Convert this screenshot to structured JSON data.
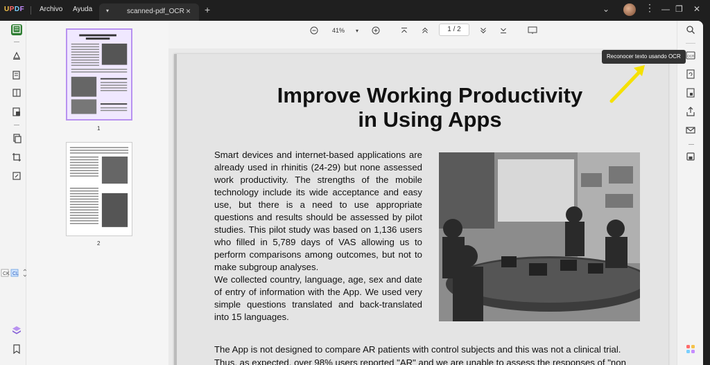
{
  "app": {
    "logo": "UPDF"
  },
  "menu": {
    "file": "Archivo",
    "help": "Ayuda"
  },
  "tab": {
    "name": "scanned-pdf_OCR",
    "close": "×",
    "new": "+"
  },
  "toolbar": {
    "zoom": "41%",
    "page_current": "1",
    "page_sep": "/",
    "page_total": "2"
  },
  "thumbnails": [
    {
      "number": "1"
    },
    {
      "number": "2"
    }
  ],
  "document": {
    "title_line1": "Improve Working Productivity",
    "title_line2": "in Using Apps",
    "paragraph1": "Smart devices and internet-based applications are already used in rhinitis (24-29) but none assessed work productivity. The strengths of the mobile technology include its wide acceptance and easy use, but there is a need to use appropriate questions and results should be assessed by pilot studies. This pilot study was based on 1,136 users who filled in 5,789 days of VAS allowing us to perform comparisons among outcomes, but not to make subgroup analyses.",
    "paragraph2": "We collected country, language, age, sex and date of entry of information with the App. We used very simple questions translated and back-translated into 15 languages.",
    "bottom_line1": "The App is not designed to compare AR patients with control subjects and this was not a clinical trial.",
    "bottom_line2": "Thus, as expected, over 98% users reported \"AR\" and we are unable to assess the responses of \"non"
  },
  "tooltip": {
    "ocr": "Reconocer texto usando OCR"
  },
  "colors": {
    "accent": "#2e7d32",
    "selection": "#b892f0",
    "arrow": "#f5e100"
  }
}
